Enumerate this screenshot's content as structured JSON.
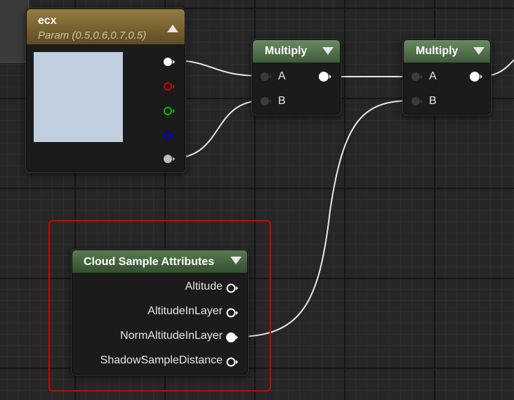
{
  "nodes": {
    "param": {
      "title": "ecx",
      "subtitle": "Param (0.5,0.6,0.7,0.5)",
      "swatch_color": "#bfcfdf",
      "header_color": "#7a6530",
      "outputs": [
        {
          "name": "rgb",
          "color": "#ffffff"
        },
        {
          "name": "r",
          "color": "#d40000"
        },
        {
          "name": "g",
          "color": "#00c000"
        },
        {
          "name": "b",
          "color": "#0000d4"
        },
        {
          "name": "a",
          "color": "#bdbdbd"
        }
      ]
    },
    "multiply1": {
      "title": "Multiply",
      "header_color": "#4e6b48",
      "inputs": [
        {
          "label": "A"
        },
        {
          "label": "B"
        }
      ]
    },
    "multiply2": {
      "title": "Multiply",
      "header_color": "#4e6b48",
      "inputs": [
        {
          "label": "A"
        },
        {
          "label": "B"
        }
      ]
    },
    "cloud": {
      "title": "Cloud Sample Attributes",
      "header_color": "#3d5a3a",
      "outputs": [
        {
          "label": "Altitude",
          "connected": false
        },
        {
          "label": "AltitudeInLayer",
          "connected": false
        },
        {
          "label": "NormAltitudeInLayer",
          "connected": true
        },
        {
          "label": "ShadowSampleDistance",
          "connected": false
        }
      ]
    }
  },
  "colors": {
    "wire": "#e8e8e8",
    "highlight": "#d40000",
    "canvas": "#262626"
  }
}
